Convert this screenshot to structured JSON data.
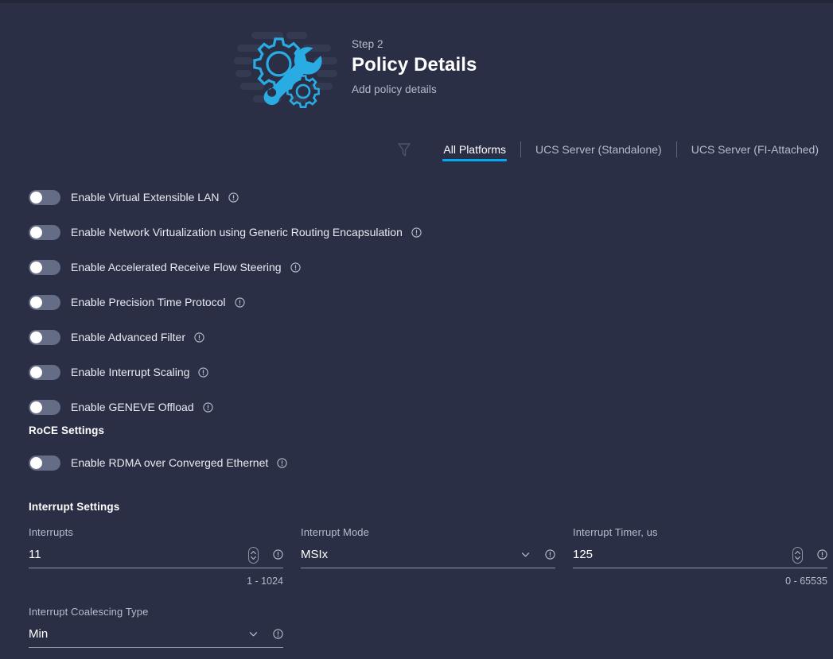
{
  "header": {
    "step_label": "Step 2",
    "title": "Policy Details",
    "subtitle": "Add policy details",
    "illustration_icon": "gear-wrench-illustration",
    "accent_color": "#29ace3",
    "background_color": "#2a2f45"
  },
  "tabs_bar": {
    "filter_icon": "filter-funnel-icon",
    "tabs": [
      {
        "label": "All Platforms",
        "active": true
      },
      {
        "label": "UCS Server (Standalone)",
        "active": false
      },
      {
        "label": "UCS Server (FI-Attached)",
        "active": false
      }
    ]
  },
  "toggles": [
    {
      "label": "Enable Virtual Extensible LAN",
      "state": "off",
      "info_icon": "info-circle-icon"
    },
    {
      "label": "Enable Network Virtualization using Generic Routing Encapsulation",
      "state": "off",
      "info_icon": "info-circle-icon"
    },
    {
      "label": "Enable Accelerated Receive Flow Steering",
      "state": "off",
      "info_icon": "info-circle-icon"
    },
    {
      "label": "Enable Precision Time Protocol",
      "state": "off",
      "info_icon": "info-circle-icon"
    },
    {
      "label": "Enable Advanced Filter",
      "state": "off",
      "info_icon": "info-circle-icon"
    },
    {
      "label": "Enable Interrupt Scaling",
      "state": "off",
      "info_icon": "info-circle-icon"
    },
    {
      "label": "Enable GENEVE Offload",
      "state": "off",
      "info_icon": "info-circle-icon"
    }
  ],
  "roce": {
    "heading": "RoCE Settings",
    "toggles": [
      {
        "label": "Enable RDMA over Converged Ethernet",
        "state": "off",
        "info_icon": "info-circle-icon"
      }
    ]
  },
  "interrupt": {
    "heading": "Interrupt Settings",
    "fields": [
      {
        "label": "Interrupts",
        "value": "11",
        "hint": "1 - 1024",
        "control": "stepper",
        "info_icon": "info-circle-icon"
      },
      {
        "label": "Interrupt Mode",
        "value": "MSIx",
        "hint": "",
        "control": "dropdown",
        "info_icon": "info-circle-icon"
      },
      {
        "label": "Interrupt Timer, us",
        "value": "125",
        "hint": "0 - 65535",
        "control": "stepper",
        "info_icon": "info-circle-icon"
      },
      {
        "label": "Interrupt Coalescing Type",
        "value": "Min",
        "hint": "",
        "control": "dropdown",
        "info_icon": "info-circle-icon"
      }
    ]
  }
}
